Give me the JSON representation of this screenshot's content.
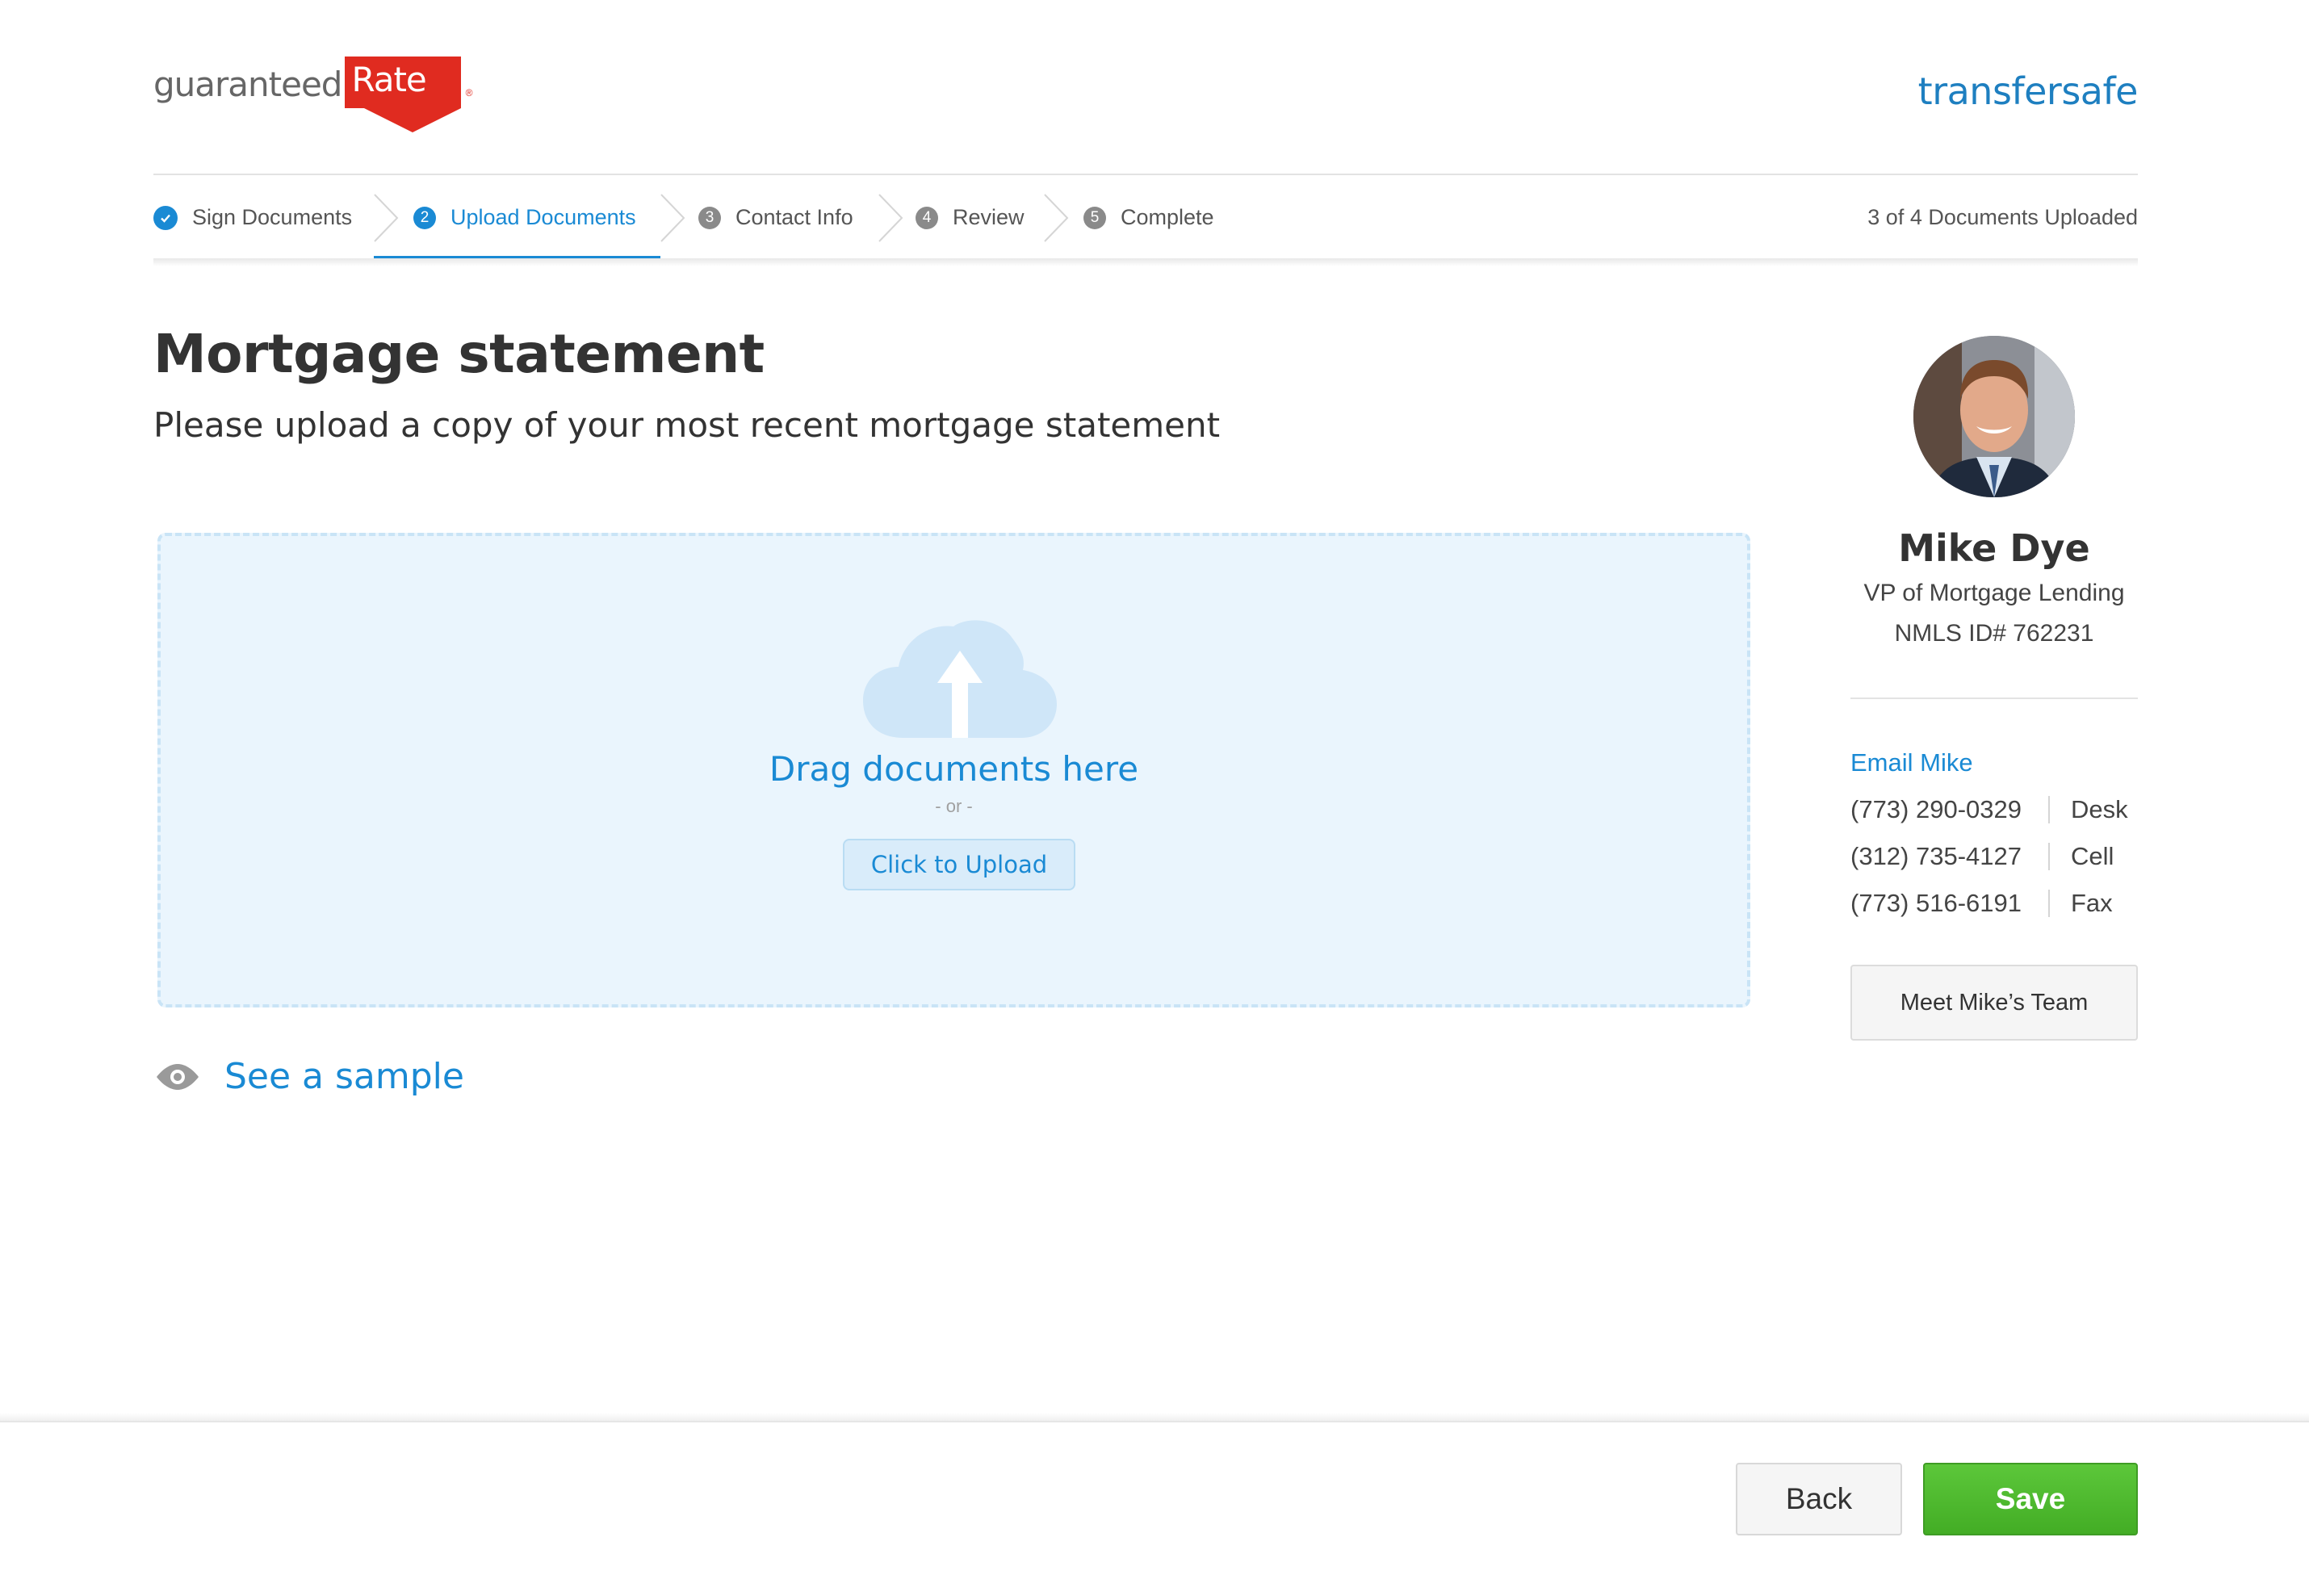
{
  "header": {
    "logo_word": "guaranteed",
    "logo_rate": "Rate",
    "logo_reg": "®",
    "brand": "transfersafe"
  },
  "steps": [
    {
      "label": "Sign Documents",
      "state": "done"
    },
    {
      "number": "2",
      "label": "Upload Documents",
      "state": "active"
    },
    {
      "number": "3",
      "label": "Contact Info",
      "state": "pending"
    },
    {
      "number": "4",
      "label": "Review",
      "state": "pending"
    },
    {
      "number": "5",
      "label": "Complete",
      "state": "pending"
    }
  ],
  "progress_text": "3 of 4 Documents Uploaded",
  "main": {
    "title": "Mortgage statement",
    "subtitle": "Please upload a copy of your most recent mortgage statement",
    "dropzone": {
      "drag_text": "Drag documents here",
      "or_text": "- or -",
      "upload_label": "Click to Upload"
    },
    "sample_label": "See a sample"
  },
  "agent": {
    "name": "Mike Dye",
    "title": "VP of Mortgage Lending",
    "nmls": "NMLS ID# 762231",
    "email_label": "Email Mike",
    "phones": [
      {
        "number": "(773) 290-0329",
        "type": "Desk"
      },
      {
        "number": "(312) 735-4127",
        "type": "Cell"
      },
      {
        "number": "(773) 516-6191",
        "type": "Fax"
      }
    ],
    "team_button": "Meet Mike’s Team"
  },
  "footer": {
    "back_label": "Back",
    "save_label": "Save"
  },
  "colors": {
    "accent": "#1a8ad4",
    "brand_red": "#e02b20",
    "save_green": "#4cb82c",
    "dropzone_bg": "#eaf5fd"
  },
  "icons": {
    "step_done": "check-circle-icon",
    "sample": "eye-icon",
    "upload": "cloud-upload-icon"
  }
}
